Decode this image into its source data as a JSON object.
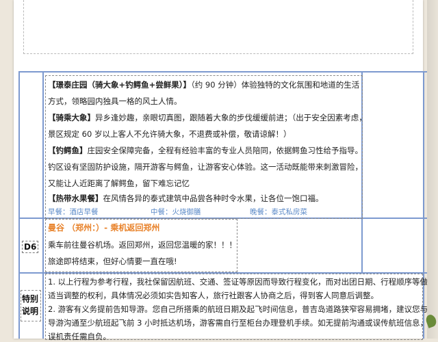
{
  "day_row": {
    "attractions": [
      {
        "title": "【璟泰庄园（骑大象+钓鳄鱼+尝鲜果）】",
        "text": "（约 90 分钟）体验独特的文化氛围和地道的生活"
      },
      {
        "text": "方式，领略园内独具一格的风土人情。"
      },
      {
        "title": "【骑乘大象】",
        "text": "异乡逢妙趣，亲眼切真图，跟随着大象的步伐缓缓前进；（出于安全因素考虑，"
      },
      {
        "text": "景区规定 60 岁以上客人不允许骑大象，不退费或补偿，敬请谅解！）"
      },
      {
        "title": "【钓鳄鱼】",
        "text": "庄园安全保障完备，全程有经验丰富的专业人员陪同，依据鳄鱼习性给予指导。"
      },
      {
        "text": "钓区设有坚固防护设施，隔开游客与鳄鱼，让游客安心体验。这一活动既能带来刺激冒险，"
      },
      {
        "text": "又能让人近距离了解鳄鱼，留下难忘记忆"
      },
      {
        "title": "【热带水果餐】",
        "text": "在风情各异的泰式建筑中品尝各种时令水果，让各位一饱口福。"
      }
    ],
    "meals": {
      "breakfast": "早餐：酒店早餐",
      "lunch": "中餐：火烧御膳",
      "dinner": "晚餐：泰式私房菜"
    }
  },
  "d6": {
    "label": "D6",
    "title": "曼谷 （郑州：）- 乘机返回郑州",
    "line1": "乘车前往曼谷机场。返回郑州，返回您温暖的家！！！",
    "line2": "旅途即将结束，但好心情要一直在哦!"
  },
  "notes": {
    "label_line1": "特别",
    "label_line2": "说明",
    "lines": [
      "1. 以上行程为参考行程，我社保留因航班、交通、签证等原因而导致行程变化，而对出团日期、行程顺序等做",
      "适当调整的权利，具体情况必须如实告知客人，旅行社跟客人协商之后，得到客人同意后调整。",
      "2. 游客有义务提前告知导游。您自己所搭乘的航班日期及起飞时间信息，普吉岛道路狭窄容易拥堵，建议您与",
      "导游沟通至少航班起飞前 3 小时抵达机场，游客需自行至柜台办理登机手续。如无提前沟通或误传航班信息，",
      "误机责任需自负。"
    ]
  }
}
